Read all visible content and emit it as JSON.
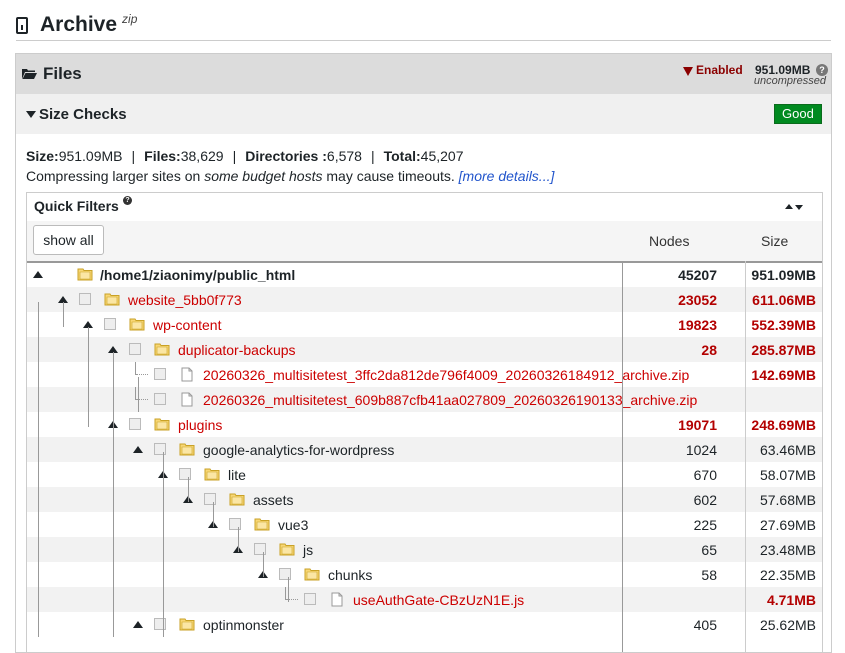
{
  "header": {
    "title": "Archive",
    "sup": "zip"
  },
  "files": {
    "title": "Files",
    "status": "Enabled",
    "size": "951.09MB",
    "help": "?",
    "size_note": "uncompressed"
  },
  "size_checks": {
    "title": "Size Checks",
    "badge": "Good",
    "summary": {
      "size_label": "Size:",
      "size": "951.09MB",
      "files_label": "Files:",
      "files": "38,629",
      "dirs_label": "Directories :",
      "dirs": "6,578",
      "total_label": "Total:",
      "total": "45,207"
    },
    "note": {
      "pre": "Compressing larger sites on ",
      "em": "some budget hosts",
      "post": " may cause timeouts. ",
      "link": "[more details...]"
    }
  },
  "quick_filters": {
    "title": "Quick Filters",
    "help": "?",
    "show_all": "show all",
    "col_nodes": "Nodes",
    "col_size": "Size"
  },
  "tree": [
    {
      "name": "/home1/ziaonimy/public_html",
      "nodes": "45207",
      "size": "951.09MB",
      "depth": 0,
      "type": "folder",
      "style": "root"
    },
    {
      "name": "website_5bb0f773",
      "nodes": "23052",
      "size": "611.06MB",
      "depth": 1,
      "type": "folder",
      "style": "warn"
    },
    {
      "name": "wp-content",
      "nodes": "19823",
      "size": "552.39MB",
      "depth": 2,
      "type": "folder",
      "style": "warn"
    },
    {
      "name": "duplicator-backups",
      "nodes": "28",
      "size": "285.87MB",
      "depth": 3,
      "type": "folder",
      "style": "warn"
    },
    {
      "name": "20260326_multisitetest_3ffc2da812de796f4009_20260326184912_archive.zip",
      "nodes": "",
      "size": "142.69MB",
      "depth": 4,
      "type": "file",
      "style": "warn"
    },
    {
      "name": "20260326_multisitetest_609b887cfb41aa027809_20260326190133_archive.zip",
      "nodes": "",
      "size": "",
      "depth": 4,
      "type": "file",
      "style": "warn"
    },
    {
      "name": "plugins",
      "nodes": "19071",
      "size": "248.69MB",
      "depth": 3,
      "type": "folder",
      "style": "warn"
    },
    {
      "name": "google-analytics-for-wordpress",
      "nodes": "1024",
      "size": "63.46MB",
      "depth": 4,
      "type": "folder",
      "style": "normal"
    },
    {
      "name": "lite",
      "nodes": "670",
      "size": "58.07MB",
      "depth": 5,
      "type": "folder",
      "style": "normal"
    },
    {
      "name": "assets",
      "nodes": "602",
      "size": "57.68MB",
      "depth": 6,
      "type": "folder",
      "style": "normal"
    },
    {
      "name": "vue3",
      "nodes": "225",
      "size": "27.69MB",
      "depth": 7,
      "type": "folder",
      "style": "normal"
    },
    {
      "name": "js",
      "nodes": "65",
      "size": "23.48MB",
      "depth": 8,
      "type": "folder",
      "style": "normal"
    },
    {
      "name": "chunks",
      "nodes": "58",
      "size": "22.35MB",
      "depth": 9,
      "type": "folder",
      "style": "normal"
    },
    {
      "name": "useAuthGate-CBzUzN1E.js",
      "nodes": "",
      "size": "4.71MB",
      "depth": 10,
      "type": "file",
      "style": "warn"
    },
    {
      "name": "optinmonster",
      "nodes": "405",
      "size": "25.62MB",
      "depth": 4,
      "type": "folder",
      "style": "normal"
    }
  ],
  "colors": {
    "warn": "#cc0000",
    "good": "#008a20",
    "enabled": "#8b0000"
  }
}
